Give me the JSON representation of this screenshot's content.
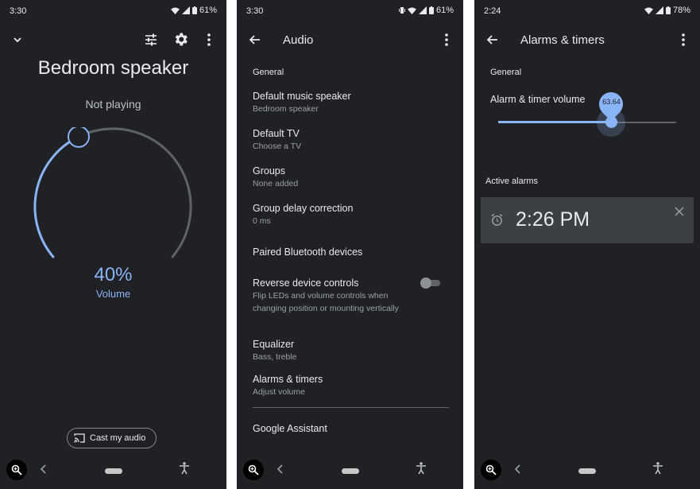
{
  "screen1": {
    "status": {
      "time": "3:30",
      "battery": "61%"
    },
    "title": "Bedroom speaker",
    "subtitle": "Not playing",
    "volume": {
      "value": 0.4,
      "percent_label": "40%",
      "label": "Volume"
    },
    "cast_button": "Cast my audio",
    "icons": [
      "chevron-down-icon",
      "equalizer-icon",
      "gear-icon",
      "more-vert-icon"
    ]
  },
  "screen2": {
    "status": {
      "time": "3:30",
      "battery": "61%"
    },
    "title": "Audio",
    "section": "General",
    "items": [
      {
        "title": "Default music speaker",
        "subtitle": "Bedroom speaker"
      },
      {
        "title": "Default TV",
        "subtitle": "Choose a TV"
      },
      {
        "title": "Groups",
        "subtitle": "None added"
      },
      {
        "title": "Group delay correction",
        "subtitle": "0 ms"
      },
      {
        "title": "Paired Bluetooth devices",
        "subtitle": ""
      },
      {
        "title": "Reverse device controls",
        "subtitle": "Flip LEDs and volume controls when changing position or mounting vertically",
        "toggle": false
      },
      {
        "title": "Equalizer",
        "subtitle": "Bass, treble"
      },
      {
        "title": "Alarms & timers",
        "subtitle": "Adjust volume"
      }
    ],
    "footer_item": "Google Assistant"
  },
  "screen3": {
    "status": {
      "time": "2:24",
      "battery": "78%"
    },
    "title": "Alarms & timers",
    "section": "General",
    "slider_label": "Alarm & timer volume",
    "slider_value": 63.64,
    "slider_value_label": "63.64",
    "slider_fraction": 0.636,
    "active_alarms_label": "Active alarms",
    "alarm_time": "2:26 PM"
  },
  "colors": {
    "background": "#202124",
    "accent": "#8ab4f8",
    "text": "#e8eaed",
    "muted": "#9aa0a6",
    "card": "#3c4043"
  }
}
